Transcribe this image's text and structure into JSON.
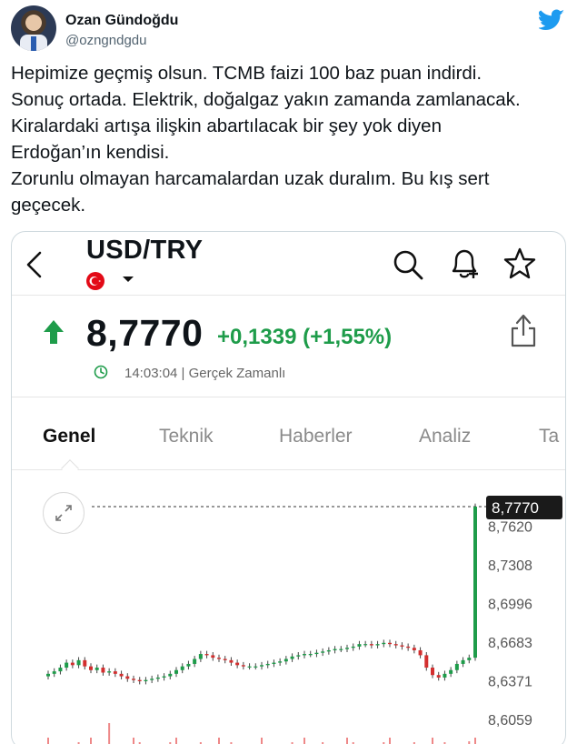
{
  "tweet": {
    "display_name": "Ozan Gündoğdu",
    "handle": "@ozngndgdu",
    "lines": [
      "Hepimize geçmiş olsun. TCMB faizi 100 baz puan indirdi.",
      "Sonuç ortada. Elektrik, doğalgaz yakın zamanda zamlanacak.",
      "Kiralardaki artışa ilişkin abartılacak bir şey yok diyen",
      "Erdoğan’ın kendisi.",
      "Zorunlu olmayan harcamalardan uzak duralım. Bu kış sert",
      "geçecek."
    ]
  },
  "app": {
    "pair": "USD/TRY",
    "price": "8,7770",
    "change": "+0,1339 (+1,55%)",
    "time": "14:03:04 | Gerçek Zamanlı",
    "tabs": [
      "Genel",
      "Teknik",
      "Haberler",
      "Analiz",
      "Ta"
    ],
    "active_tab": "Genel"
  },
  "colors": {
    "up": "#1e9c4a",
    "down": "#d32f2f",
    "twitter": "#1d9bf0"
  },
  "icons": [
    "avatar",
    "twitter-icon",
    "back-icon",
    "flag-icon",
    "search-icon",
    "bell-plus-icon",
    "star-icon",
    "up-arrow-icon",
    "share-icon",
    "clock-icon",
    "expand-icon"
  ],
  "chart_data": {
    "type": "candlestick",
    "current_price_label": "8,7770",
    "y_tick_labels": [
      "8,7620",
      "8,7308",
      "8,6996",
      "8,6683",
      "8,6371",
      "8,6059"
    ],
    "y_ticks": [
      8.762,
      8.7308,
      8.6996,
      8.6683,
      8.6371,
      8.6059
    ],
    "ylim": [
      8.596,
      8.78
    ],
    "current_price": 8.777,
    "candles_close": [
      8.642,
      8.644,
      8.647,
      8.651,
      8.649,
      8.653,
      8.648,
      8.645,
      8.647,
      8.643,
      8.644,
      8.642,
      8.64,
      8.638,
      8.637,
      8.636,
      8.637,
      8.638,
      8.639,
      8.64,
      8.642,
      8.645,
      8.648,
      8.65,
      8.654,
      8.658,
      8.657,
      8.655,
      8.654,
      8.653,
      8.651,
      8.649,
      8.648,
      8.648,
      8.648,
      8.649,
      8.65,
      8.651,
      8.652,
      8.654,
      8.656,
      8.657,
      8.658,
      8.658,
      8.659,
      8.66,
      8.661,
      8.662,
      8.662,
      8.663,
      8.664,
      8.666,
      8.666,
      8.665,
      8.666,
      8.667,
      8.666,
      8.665,
      8.664,
      8.663,
      8.661,
      8.657,
      8.647,
      8.641,
      8.639,
      8.642,
      8.645,
      8.65,
      8.653,
      8.655,
      8.777
    ]
  }
}
